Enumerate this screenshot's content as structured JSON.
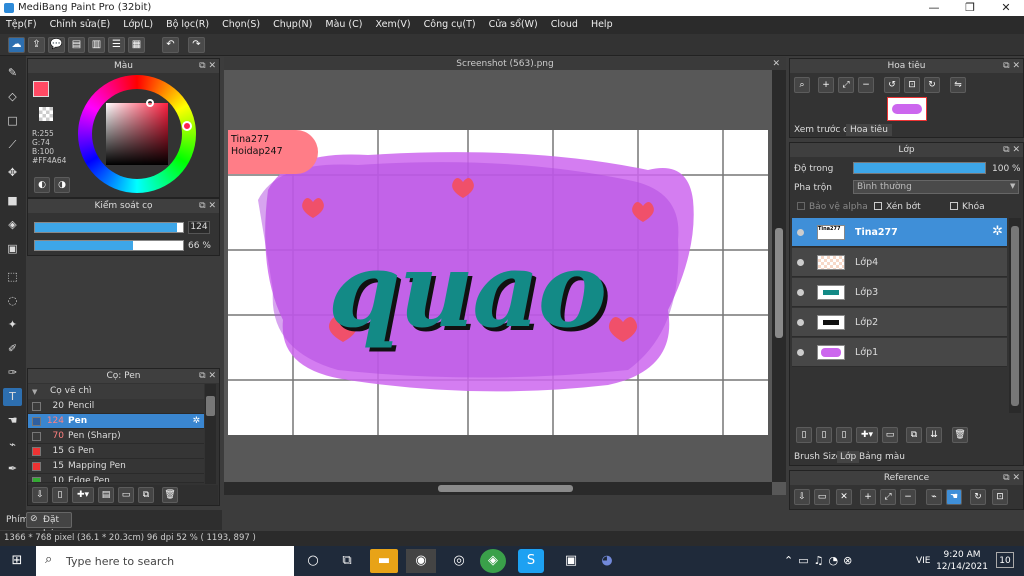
{
  "window": {
    "title": "MediBang Paint Pro (32bit)",
    "min": "—",
    "max": "❐",
    "close": "✕"
  },
  "menu": [
    "Tệp(F)",
    "Chỉnh sửa(E)",
    "Lớp(L)",
    "Bộ lọc(R)",
    "Chọn(S)",
    "Chụp(N)",
    "Màu (C)",
    "Xem(V)",
    "Công cụ(T)",
    "Cửa sổ(W)",
    "Cloud",
    "Help"
  ],
  "color_panel": {
    "title": "Màu",
    "r": "R:255",
    "g": "G:74",
    "b": "B:100",
    "hex": "#FF4A64",
    "primary": "#ff4a64"
  },
  "brush_control": {
    "title": "Kiểm soát cọ",
    "size": "124",
    "size_pct": 0.96,
    "opacity": "66 %",
    "opacity_pct": 0.66
  },
  "brush_panel": {
    "title": "Cọ: Pen",
    "group": "Cọ vẽ chì",
    "items": [
      {
        "n": "20",
        "label": "Pencil",
        "color": "#3a3a3a"
      },
      {
        "n": "124",
        "label": "Pen",
        "color": "#2f5f9f",
        "selected": true
      },
      {
        "n": "70",
        "label": "Pen (Sharp)",
        "color": "#3a3a3a"
      },
      {
        "n": "15",
        "label": "G Pen",
        "color": "#ee3333"
      },
      {
        "n": "15",
        "label": "Mapping Pen",
        "color": "#ee3333"
      },
      {
        "n": "10",
        "label": "Edge Pen",
        "color": "#33aa33"
      }
    ]
  },
  "bottom_left": {
    "tab": "Phím",
    "undo": "Đặt lại"
  },
  "canvas": {
    "tab": "Screenshot (563).png",
    "note_line1": "Tina277",
    "note_line2": "Hoidap247",
    "art_text": "quao"
  },
  "navigator": {
    "title": "Hoa tiêu",
    "tab1": "Xem trước cọ",
    "tab2": "Hoa tiêu"
  },
  "layer_panel": {
    "title": "Lớp",
    "opacity_label": "Độ trong",
    "opacity_val": "100 %",
    "blend_label": "Pha trộn",
    "blend_val": "Bình thường",
    "protect_alpha": "Bảo vệ alpha",
    "clipping": "Xén bớt",
    "lock": "Khóa",
    "layers": [
      {
        "name": "Tina277",
        "selected": true
      },
      {
        "name": "Lớp4"
      },
      {
        "name": "Lớp3"
      },
      {
        "name": "Lớp2"
      },
      {
        "name": "Lớp1"
      }
    ],
    "tab_brush": "Brush Size",
    "tab_layer": "Lớp",
    "tab_palette": "Bảng màu"
  },
  "reference": {
    "title": "Reference"
  },
  "status": {
    "text": "1366 * 768 pixel   (36.1 * 20.3cm)   96 dpi   52 %   ( 1193, 897 )"
  },
  "taskbar": {
    "search": "Type here to search",
    "time": "9:20 AM",
    "date": "12/14/2021",
    "lang": "VIE",
    "notif": "10"
  }
}
